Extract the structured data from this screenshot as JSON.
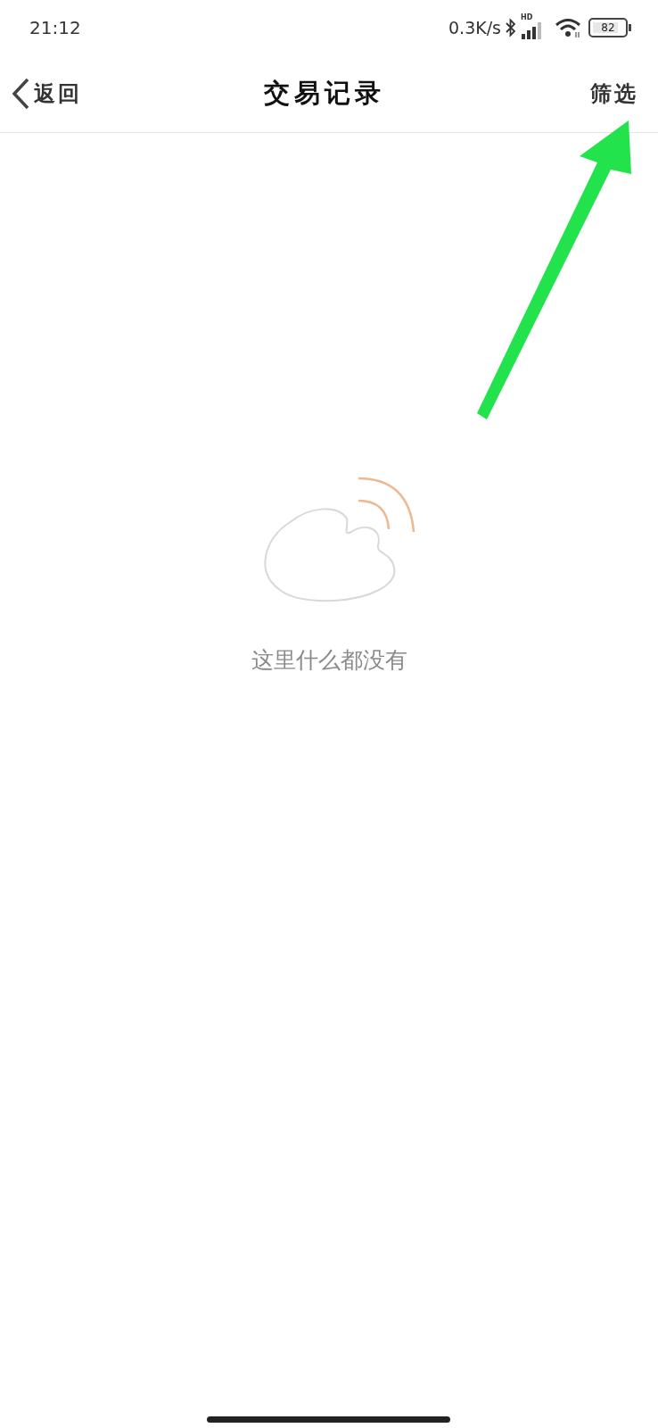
{
  "status_bar": {
    "time": "21:12",
    "net_speed": "0.3K/s",
    "signal_label": "HD",
    "battery": "82"
  },
  "header": {
    "back": "返回",
    "title": "交易记录",
    "action": "筛选"
  },
  "empty_state": {
    "message": "这里什么都没有"
  }
}
